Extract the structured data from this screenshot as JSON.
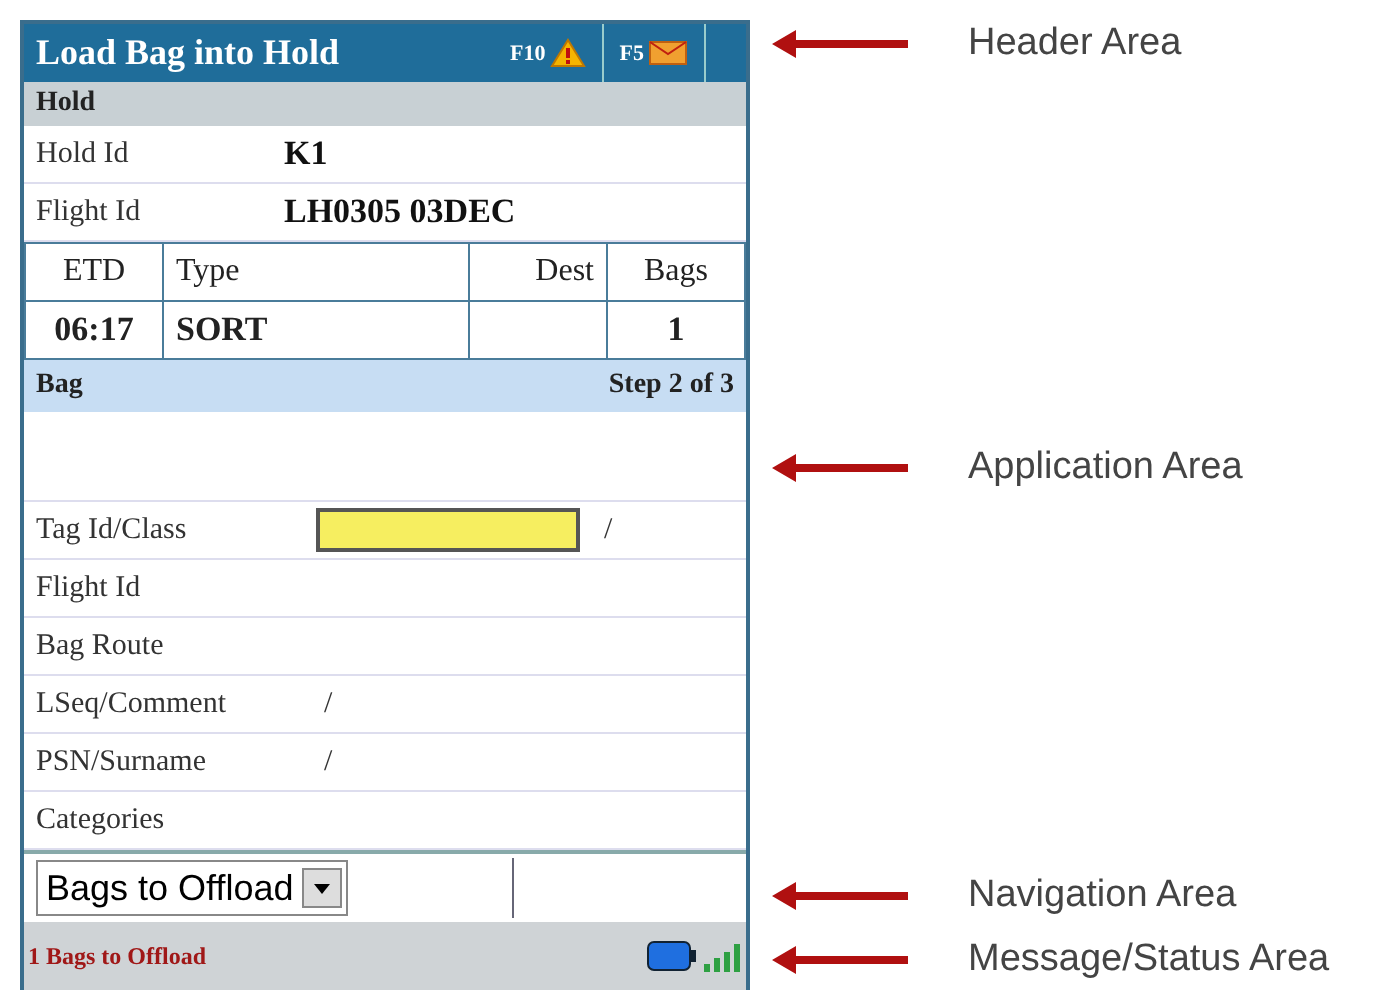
{
  "header": {
    "title": "Load Bag into Hold",
    "keys": [
      {
        "key": "F10",
        "kind": "warning"
      },
      {
        "key": "F5",
        "kind": "mail"
      }
    ]
  },
  "hold_section": {
    "title": "Hold"
  },
  "hold_fields": [
    {
      "label": "Hold Id",
      "value": "K1"
    },
    {
      "label": "Flight Id",
      "value": "LH0305 03DEC"
    }
  ],
  "flight_table": {
    "columns": [
      "ETD",
      "Type",
      "Dest",
      "Bags"
    ],
    "rows": [
      [
        "06:17",
        "SORT",
        "",
        "1"
      ]
    ]
  },
  "bag_section": {
    "title": "Bag",
    "step": "Step 2 of 3"
  },
  "bag_fields": [
    {
      "label": "Tag Id/Class",
      "kind": "input",
      "separator": "/"
    },
    {
      "label": "Flight Id",
      "kind": "text"
    },
    {
      "label": "Bag Route",
      "kind": "text"
    },
    {
      "label": "LSeq/Comment",
      "kind": "text",
      "separator": "/"
    },
    {
      "label": "PSN/Surname",
      "kind": "text",
      "separator": "/"
    },
    {
      "label": "Categories",
      "kind": "text"
    }
  ],
  "navigation": {
    "dropdown": "Bags to Offload"
  },
  "status_bar": {
    "message": "1 Bags to Offload"
  },
  "annotations": [
    {
      "label": "Header Area"
    },
    {
      "label": "Application Area"
    },
    {
      "label": "Navigation Area"
    },
    {
      "label": "Message/Status Area"
    }
  ]
}
